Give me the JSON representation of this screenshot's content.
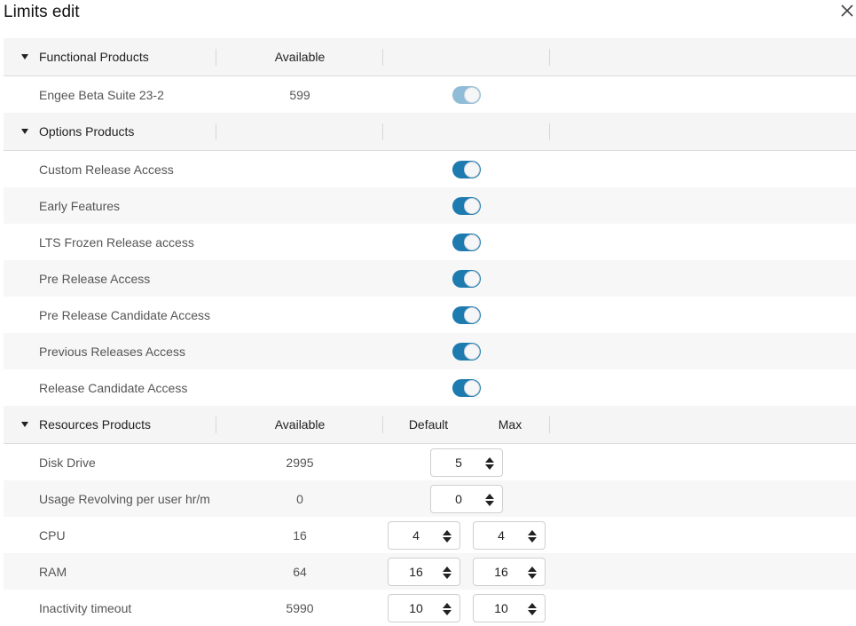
{
  "dialog": {
    "title": "Limits edit",
    "close_icon": "close-icon"
  },
  "groups": {
    "functional": {
      "title": "Functional Products",
      "col_available": "Available",
      "rows": [
        {
          "name": "Engee Beta Suite 23-2",
          "available": "599",
          "enabled": true
        }
      ]
    },
    "options": {
      "title": "Options Products",
      "rows": [
        {
          "name": "Custom Release Access",
          "enabled": true
        },
        {
          "name": "Early Features",
          "enabled": true
        },
        {
          "name": "LTS Frozen Release access",
          "enabled": true
        },
        {
          "name": "Pre Release Access",
          "enabled": true
        },
        {
          "name": "Pre Release Candidate Access",
          "enabled": true
        },
        {
          "name": "Previous Releases Access",
          "enabled": true
        },
        {
          "name": "Release Candidate Access",
          "enabled": true
        }
      ]
    },
    "resources": {
      "title": "Resources Products",
      "col_available": "Available",
      "col_default": "Default",
      "col_max": "Max",
      "rows": [
        {
          "name": "Disk Drive",
          "available": "2995",
          "value": "5"
        },
        {
          "name": "Usage Revolving per user hr/m",
          "available": "0",
          "value": "0"
        },
        {
          "name": "CPU",
          "available": "16",
          "default": "4",
          "max": "4"
        },
        {
          "name": "RAM",
          "available": "64",
          "default": "16",
          "max": "16"
        },
        {
          "name": "Inactivity timeout",
          "available": "5990",
          "default": "10",
          "max": "10"
        }
      ]
    }
  },
  "colors": {
    "toggle_on": "#1d7bb0",
    "toggle_disabled": "#8fbcd6",
    "group_bg": "#f5f5f5",
    "row_alt_bg": "#f7f7f7"
  }
}
